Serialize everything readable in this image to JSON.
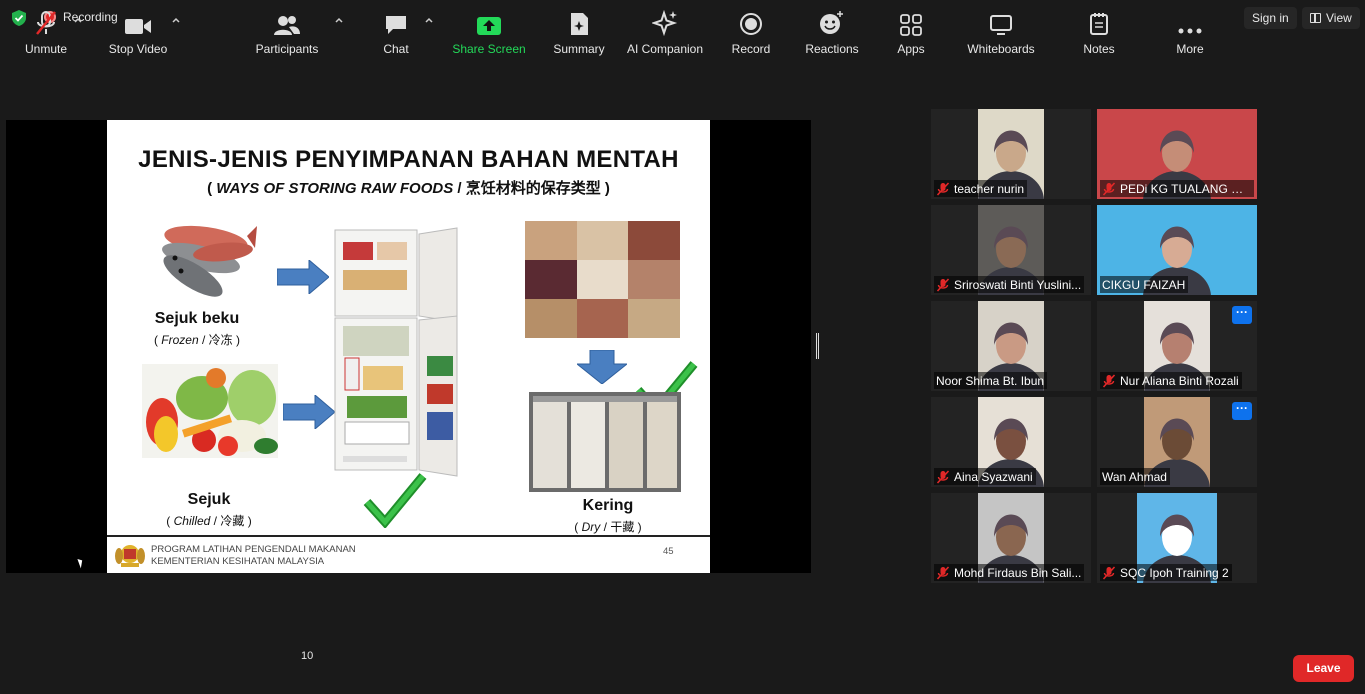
{
  "topbar": {
    "recording_label": "Recording",
    "sign_in_label": "Sign in",
    "view_label": "View"
  },
  "slide": {
    "title": "JENIS-JENIS PENYIMPANAN BAHAN MENTAH",
    "subtitle_en": "WAYS OF STORING RAW FOODS",
    "subtitle_sep": "/",
    "subtitle_zh": "烹饪材料的保存类型",
    "frozen": {
      "main": "Sejuk beku",
      "en": "Frozen",
      "zh": "冷冻"
    },
    "chilled": {
      "main": "Sejuk",
      "en": "Chilled",
      "zh": "冷藏"
    },
    "dry": {
      "main": "Kering",
      "en": "Dry",
      "zh": "干藏"
    },
    "footer_line1": "PROGRAM LATIHAN PENGENDALI MAKANAN",
    "footer_line2": "KEMENTERIAN KESIHATAN MALAYSIA",
    "page_number": "45"
  },
  "participants": [
    {
      "name": "teacher nurin",
      "muted": true,
      "skin": "#c9a88a",
      "bg": "#ded9c8"
    },
    {
      "name": "PEDi KG TUALANG SE...",
      "muted": true,
      "skin": "#c58d77",
      "bg": "#c9474a"
    },
    {
      "name": "Sriroswati Binti Yuslini...",
      "muted": true,
      "skin": "#8a6a55",
      "bg": "#5d5b58"
    },
    {
      "name": "CIKGU FAIZAH",
      "muted": false,
      "skin": "#d7ab94",
      "bg": "#4db4e6",
      "active": true
    },
    {
      "name": "Noor Shima Bt. Ibun",
      "muted": false,
      "skin": "#c99a84",
      "bg": "#d7d2c8"
    },
    {
      "name": "Nur Aliana Binti Rozali",
      "muted": true,
      "skin": "#b68070",
      "bg": "#e5e0da",
      "more": true
    },
    {
      "name": "Aina Syazwani",
      "muted": true,
      "skin": "#7a5040",
      "bg": "#e6e0d6"
    },
    {
      "name": "Wan Ahmad",
      "muted": false,
      "skin": "#6b4b36",
      "bg": "#c09a78",
      "more": true
    },
    {
      "name": "Mohd Firdaus Bin Sali...",
      "muted": true,
      "skin": "#8a6650",
      "bg": "#c5c5c5"
    },
    {
      "name": "SQC Ipoh Training 2",
      "muted": true,
      "skin": "#ffffff",
      "bg": "#5fb6e8"
    }
  ],
  "toolbar": {
    "unmute": "Unmute",
    "stop_video": "Stop Video",
    "participants": "Participants",
    "participants_count": "10",
    "chat": "Chat",
    "share_screen": "Share Screen",
    "summary": "Summary",
    "ai_companion": "AI Companion",
    "record": "Record",
    "reactions": "Reactions",
    "apps": "Apps",
    "whiteboards": "Whiteboards",
    "notes": "Notes",
    "more": "More",
    "leave": "Leave"
  },
  "colors": {
    "background": "#1a1a1a",
    "accent_green": "#23d959",
    "leave_red": "#e02828",
    "active_speaker": "#f4f27c",
    "more_blue": "#0e72ed"
  }
}
